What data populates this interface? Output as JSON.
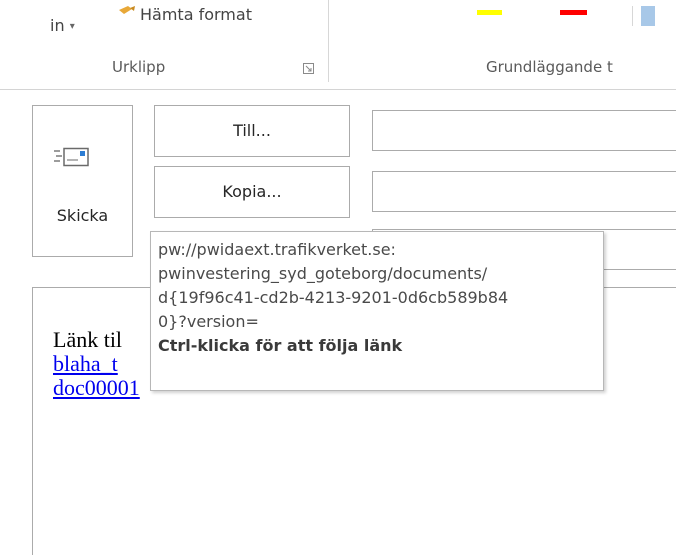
{
  "ribbon": {
    "partial_button_label": "in",
    "format_painter_label": "Hämta format",
    "clipboard_group_label": "Urklipp",
    "basic_text_group_label": "Grundläggande t",
    "highlight_color": "#ffff00",
    "font_color": "#ff0000",
    "accent_color": "#a8c8e8"
  },
  "compose": {
    "send_label": "Skicka",
    "to_label": "Till...",
    "cc_label": "Kopia...",
    "to_value": "",
    "cc_value": ""
  },
  "body": {
    "text_prefix": "Länk til",
    "link_line1": "blaha_t",
    "link_line2": "doc00001"
  },
  "tooltip": {
    "url_lines": [
      "pw://pwidaext.trafikverket.se:",
      "pwinvestering_syd_goteborg/documents/",
      "d{19f96c41-cd2b-4213-9201-0d6cb589b84",
      "0}?version="
    ],
    "hint": "Ctrl-klicka för att följa länk"
  }
}
